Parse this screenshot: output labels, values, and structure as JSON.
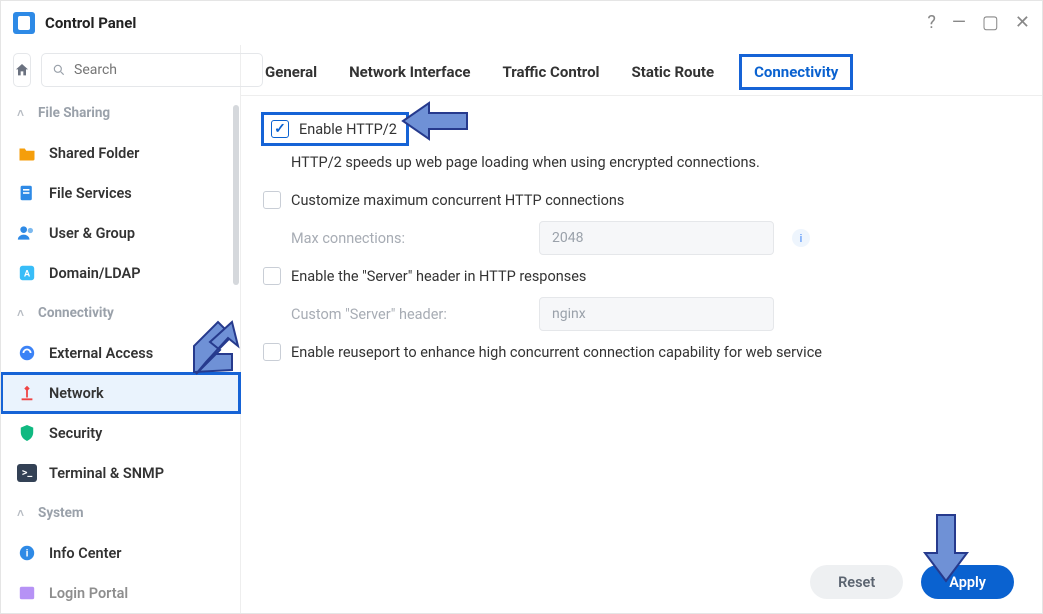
{
  "window": {
    "title": "Control Panel"
  },
  "sidebar": {
    "search_placeholder": "Search",
    "sections": {
      "file_sharing": "File Sharing",
      "connectivity": "Connectivity",
      "system": "System"
    },
    "items": {
      "shared_folder": "Shared Folder",
      "file_services": "File Services",
      "user_group": "User & Group",
      "domain_ldap": "Domain/LDAP",
      "external_access": "External Access",
      "network": "Network",
      "security": "Security",
      "terminal_snmp": "Terminal & SNMP",
      "info_center": "Info Center",
      "login_portal": "Login Portal"
    }
  },
  "tabs": {
    "general": "General",
    "network_interface": "Network Interface",
    "traffic_control": "Traffic Control",
    "static_route": "Static Route",
    "connectivity": "Connectivity"
  },
  "form": {
    "enable_http2": {
      "label": "Enable HTTP/2",
      "checked": true
    },
    "http2_desc": "HTTP/2 speeds up web page loading when using encrypted connections.",
    "customize_max": {
      "label": "Customize maximum concurrent HTTP connections",
      "checked": false
    },
    "max_conn_label": "Max connections:",
    "max_conn_value": "2048",
    "server_header": {
      "label": "Enable the \"Server\" header in HTTP responses",
      "checked": false
    },
    "custom_server_label": "Custom \"Server\" header:",
    "custom_server_value": "nginx",
    "reuseport": {
      "label": "Enable reuseport to enhance high concurrent connection capability for web service",
      "checked": false
    }
  },
  "buttons": {
    "reset": "Reset",
    "apply": "Apply"
  }
}
